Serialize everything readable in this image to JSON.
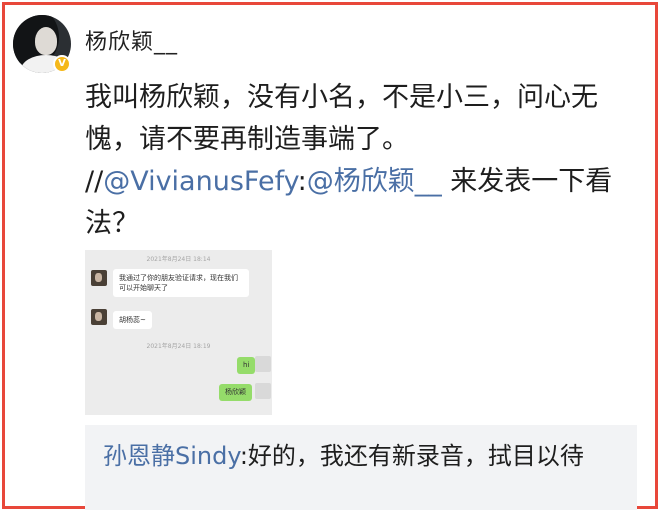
{
  "post": {
    "username": "杨欣颖__",
    "badge": "V",
    "text_main": "我叫杨欣颖，没有小名，不是小三，问心无愧，请不要再制造事端了。",
    "repost_prefix": "//",
    "mention_user": "@VivianusFefy",
    "mention_colon": ":",
    "mention_self": "@杨欣颖__",
    "text_tail": " 来发表一下看法？"
  },
  "chat_screenshot": {
    "timestamp_1": "2021年8月24日 18:14",
    "message_1": "我通过了你的朋友验证请求，现在我们可以开始聊天了",
    "message_2": "胡杨蕊~",
    "timestamp_2": "2021年8月24日 18:19",
    "reply_1": "hi",
    "reply_2": "杨欣颖"
  },
  "comment": {
    "author": "孙恩静Sindy",
    "separator": ":",
    "text": "好的，我还有新录音，拭目以待"
  },
  "colors": {
    "frame_border": "#e8473a",
    "link": "#4a6fa5",
    "badge": "#f5b81a",
    "chat_bubble_self": "#95dc6a"
  }
}
